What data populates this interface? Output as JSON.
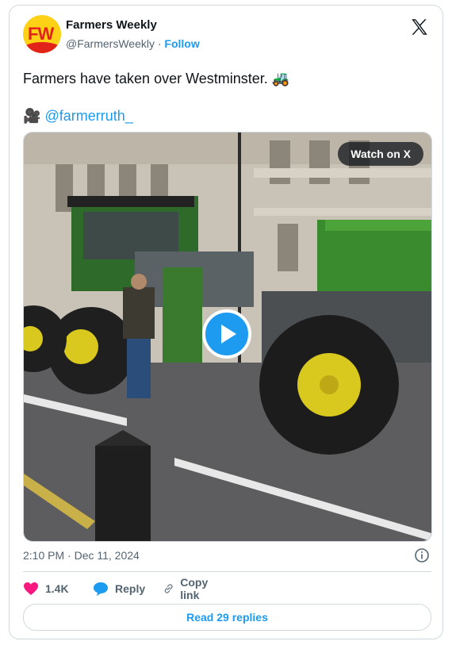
{
  "author": {
    "name": "Farmers Weekly",
    "handle": "@FarmersWeekly",
    "separator": "·",
    "follow_label": "Follow",
    "avatar_text": "FW"
  },
  "tweet": {
    "text": "Farmers have taken over Westminster.",
    "emoji": "🚜",
    "mention_prefix_icon": "🎥",
    "mention": "@farmerruth_"
  },
  "video": {
    "watch_label": "Watch on X"
  },
  "meta": {
    "timestamp": "2:10 PM · Dec 11, 2024"
  },
  "actions": {
    "likes": "1.4K",
    "reply_label": "Reply",
    "copy_label": "Copy link",
    "read_replies": "Read 29 replies"
  },
  "colors": {
    "accent": "#1d9bf0",
    "like": "#f91880",
    "border": "#cfd9de"
  },
  "icons": [
    "x-logo-icon",
    "play-icon",
    "info-icon",
    "heart-icon",
    "reply-bubble-icon",
    "link-icon",
    "camera-icon"
  ]
}
